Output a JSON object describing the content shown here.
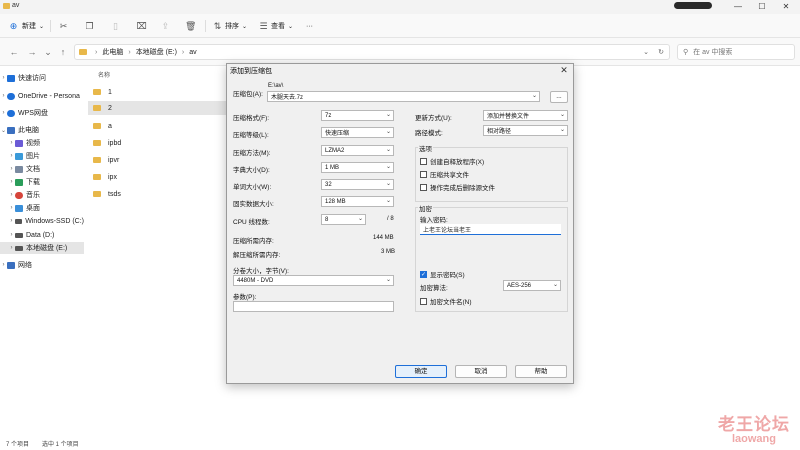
{
  "window": {
    "title": "av",
    "minimize": "—",
    "maximize": "☐",
    "close": "✕"
  },
  "toolbar": {
    "new_label": "新建",
    "sort_label": "排序",
    "view_label": "查看",
    "more": "···"
  },
  "address": {
    "back": "←",
    "forward": "→",
    "up_caret": "⌄",
    "up": "↑",
    "crumbs": [
      "此电脑",
      "本地磁盘 (E:)",
      "av"
    ],
    "dropdown": "⌄",
    "refresh": "↻",
    "search_placeholder": "在 av 中搜索"
  },
  "sidebar": {
    "items": [
      {
        "label": "快速访问",
        "color": "#1e6fd8"
      },
      {
        "label": "OneDrive - Persona",
        "color": "#1e6fd8"
      },
      {
        "label": "WPS网盘",
        "color": "#1e6fd8"
      },
      {
        "label": "此电脑",
        "color": "#3a6fbf"
      },
      {
        "label": "视频",
        "color": "#6b5bd6"
      },
      {
        "label": "图片",
        "color": "#3a9ad9"
      },
      {
        "label": "文档",
        "color": "#7a8aa0"
      },
      {
        "label": "下载",
        "color": "#2a9d5a"
      },
      {
        "label": "音乐",
        "color": "#d6453b"
      },
      {
        "label": "桌面",
        "color": "#3a8fd9"
      },
      {
        "label": "Windows-SSD (C:)",
        "color": "#555555"
      },
      {
        "label": "Data (D:)",
        "color": "#555555"
      },
      {
        "label": "本地磁盘 (E:)",
        "color": "#555555"
      },
      {
        "label": "网络",
        "color": "#3a6fbf"
      }
    ]
  },
  "files": {
    "column_name": "名称",
    "rows": [
      "1",
      "2",
      "a",
      "ipbd",
      "ipvr",
      "ipx",
      "tsds"
    ]
  },
  "status": {
    "count": "7 个项目",
    "selected": "选中 1 个项目"
  },
  "dialog": {
    "title": "添加到压缩包",
    "close": "✕",
    "archive_label": "压缩包(A):",
    "archive_path": "E:\\av\\",
    "archive_name": "木腿天去.7z",
    "browse": "...",
    "format_label": "压缩格式(F):",
    "format_value": "7z",
    "level_label": "压缩等级(L):",
    "level_value": "快速压缩",
    "method_label": "压缩方法(M):",
    "method_value": "LZMA2",
    "dict_label": "字典大小(D):",
    "dict_value": "1 MB",
    "word_label": "单词大小(W):",
    "word_value": "32",
    "solid_label": "固实数据大小:",
    "solid_value": "128 MB",
    "threads_label": "CPU 线程数:",
    "threads_value": "8",
    "threads_total": "/ 8",
    "mem_comp_label": "压缩所需内存:",
    "mem_comp_value": "144 MB",
    "mem_decomp_label": "解压缩所需内存:",
    "mem_decomp_value": "3 MB",
    "split_label": "分卷大小，字节(V):",
    "split_value": "4480M - DVD",
    "params_label": "参数(P):",
    "update_label": "更新方式(U):",
    "update_value": "添加并替换文件",
    "path_label": "路径模式:",
    "path_value": "相对路径",
    "options_group": "选项",
    "opt_sfx": "创建自释放程序(X)",
    "opt_shared": "压缩共享文件",
    "opt_delete": "操作完成后删除源文件",
    "encrypt_group": "加密",
    "password_label": "输入密码:",
    "password_value": "上老王论坛当老王",
    "show_password": "显示密码(S)",
    "enc_method_label": "加密算法:",
    "enc_method_value": "AES-256",
    "enc_names": "加密文件名(N)",
    "ok": "确定",
    "cancel": "取消",
    "help": "帮助"
  },
  "watermark": {
    "cn": "老王论坛",
    "en": "laowang"
  }
}
